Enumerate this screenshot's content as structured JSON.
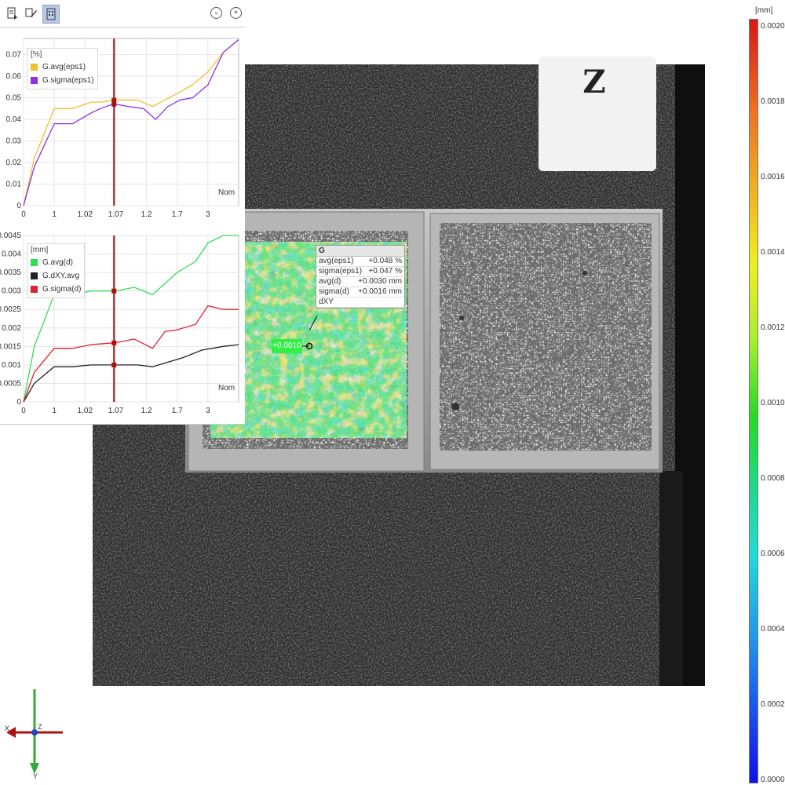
{
  "toolbar": {
    "buttons": [
      {
        "name": "export-icon",
        "active": false
      },
      {
        "name": "edit-icon",
        "active": false
      },
      {
        "name": "chart-view-icon",
        "active": true
      }
    ],
    "collapse_glyph": "⌄",
    "expand_glyph": "»"
  },
  "chart_data": [
    {
      "type": "line",
      "unit": "[%]",
      "x": [
        "0",
        "1",
        "1.02",
        "1.07",
        "1.2",
        "1.7",
        "3"
      ],
      "xlabel": "Nom",
      "ylim": [
        0,
        0.0775
      ],
      "yticks": [
        "0",
        "0.01",
        "0.02",
        "0.03",
        "0.04",
        "0.05",
        "0.06",
        "0.07"
      ],
      "grid": true,
      "cursor_x": 1.15,
      "series": [
        {
          "name": "G.avg(eps1)",
          "color": "#f0c030",
          "points": [
            [
              0,
              0
            ],
            [
              0.35,
              0.022
            ],
            [
              1,
              0.045
            ],
            [
              1.6,
              0.045
            ],
            [
              2.2,
              0.048
            ],
            [
              2.5,
              0.048
            ],
            [
              3.0,
              0.049
            ],
            [
              3.7,
              0.049
            ],
            [
              4.2,
              0.046
            ],
            [
              4.6,
              0.049
            ],
            [
              5.0,
              0.052
            ],
            [
              5.5,
              0.056
            ],
            [
              6.0,
              0.062
            ],
            [
              6.5,
              0.071
            ],
            [
              7.0,
              0.077
            ]
          ]
        },
        {
          "name": "G.sigma(eps1)",
          "color": "#8833ee",
          "points": [
            [
              0,
              0
            ],
            [
              0.35,
              0.018
            ],
            [
              1,
              0.038
            ],
            [
              1.6,
              0.038
            ],
            [
              2.2,
              0.043
            ],
            [
              2.5,
              0.045
            ],
            [
              2.9,
              0.047
            ],
            [
              3.0,
              0.047
            ],
            [
              3.4,
              0.046
            ],
            [
              3.9,
              0.045
            ],
            [
              4.3,
              0.04
            ],
            [
              4.7,
              0.046
            ],
            [
              5.1,
              0.049
            ],
            [
              5.5,
              0.05
            ],
            [
              6.0,
              0.056
            ],
            [
              6.5,
              0.071
            ],
            [
              7.0,
              0.077
            ]
          ]
        }
      ]
    },
    {
      "type": "line",
      "unit": "[mm]",
      "x": [
        "0",
        "1",
        "1.02",
        "1.07",
        "1.2",
        "1.7",
        "3"
      ],
      "xlabel": "Nom",
      "ylim": [
        0,
        0.0045
      ],
      "yticks": [
        "0",
        "0.0005",
        "0.001",
        "0.0015",
        "0.002",
        "0.0025",
        "0.003",
        "0.0035",
        "0.004",
        "0.0045"
      ],
      "grid": true,
      "cursor_x": 1.15,
      "series": [
        {
          "name": "G.avg(d)",
          "color": "#33dd55",
          "points": [
            [
              0,
              0
            ],
            [
              0.35,
              0.0015
            ],
            [
              1,
              0.0029
            ],
            [
              1.6,
              0.0029
            ],
            [
              2.2,
              0.003
            ],
            [
              3.0,
              0.003
            ],
            [
              3.6,
              0.0031
            ],
            [
              4.2,
              0.0029
            ],
            [
              4.6,
              0.0032
            ],
            [
              5.0,
              0.0035
            ],
            [
              5.6,
              0.0038
            ],
            [
              6.0,
              0.0043
            ],
            [
              6.5,
              0.0045
            ],
            [
              7.0,
              0.0045
            ]
          ]
        },
        {
          "name": "G.dXY.avg",
          "color": "#222222",
          "points": [
            [
              0,
              0
            ],
            [
              0.35,
              0.0005
            ],
            [
              1,
              0.00095
            ],
            [
              1.6,
              0.00095
            ],
            [
              2.2,
              0.001
            ],
            [
              3.0,
              0.001
            ],
            [
              3.7,
              0.001
            ],
            [
              4.2,
              0.00095
            ],
            [
              4.6,
              0.00105
            ],
            [
              5.2,
              0.0012
            ],
            [
              5.8,
              0.0014
            ],
            [
              6.5,
              0.0015
            ],
            [
              7.0,
              0.00155
            ]
          ]
        },
        {
          "name": "G.sigma(d)",
          "color": "#dd2233",
          "points": [
            [
              0,
              0
            ],
            [
              0.35,
              0.0008
            ],
            [
              1,
              0.00145
            ],
            [
              1.6,
              0.00145
            ],
            [
              2.2,
              0.00155
            ],
            [
              3.0,
              0.0016
            ],
            [
              3.6,
              0.0017
            ],
            [
              4.2,
              0.00145
            ],
            [
              4.6,
              0.0019
            ],
            [
              5.0,
              0.00195
            ],
            [
              5.6,
              0.0021
            ],
            [
              6.0,
              0.0026
            ],
            [
              6.5,
              0.0025
            ],
            [
              7.0,
              0.0025
            ]
          ]
        }
      ]
    }
  ],
  "info_box": {
    "title": "G",
    "rows": [
      {
        "label": "avg(eps1)",
        "value": "+0.048 %"
      },
      {
        "label": "sigma(eps1)",
        "value": "+0.047 %"
      },
      {
        "label": "avg(d)",
        "value": "+0.0030 mm"
      },
      {
        "label": "sigma(d)",
        "value": "+0.0016 mm"
      },
      {
        "label": "dXY",
        "value": ""
      }
    ]
  },
  "point_label": "+0.0010",
  "specimen_label": "Z",
  "color_scale": {
    "unit": "[mm]",
    "ticks": [
      "0.0020",
      "0.0018",
      "0.0016",
      "0.0014",
      "0.0012",
      "0.0010",
      "0.0008",
      "0.0006",
      "0.0004",
      "0.0002",
      "0.0000"
    ]
  },
  "axes": {
    "x": "X",
    "y": "Y",
    "z": "Z"
  }
}
